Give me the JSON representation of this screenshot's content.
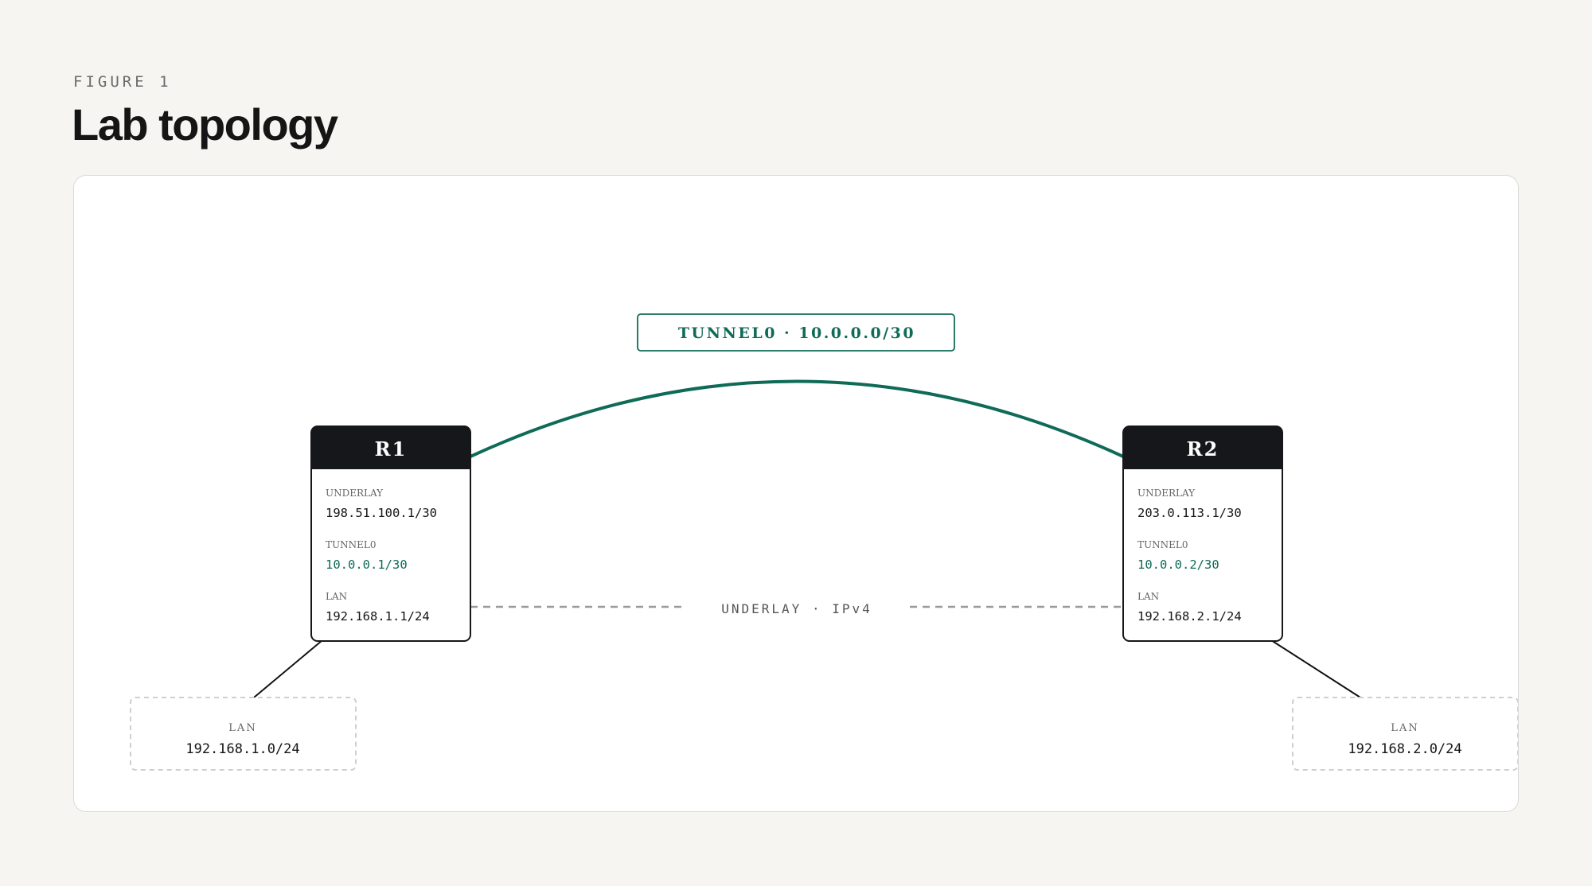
{
  "header": {
    "eyebrow": "FIGURE 1",
    "title": "Lab topology"
  },
  "colors": {
    "tunnel": "#0f6b57",
    "router_head": "#16171a",
    "underlay": "#9a9a9a",
    "lan_border": "#cfcfcf"
  },
  "diagram": {
    "tunnel_label": "TUNNEL0 · 10.0.0.0/30",
    "underlay_label": "UNDERLAY · IPv4",
    "routers": [
      {
        "name": "R1",
        "underlay_label": "UNDERLAY",
        "underlay_ip": "198.51.100.1/30",
        "tunnel_label": "TUNNEL0",
        "tunnel_ip": "10.0.0.1/30",
        "lan_label": "LAN",
        "lan_ip": "192.168.1.1/24"
      },
      {
        "name": "R2",
        "underlay_label": "UNDERLAY",
        "underlay_ip": "203.0.113.1/30",
        "tunnel_label": "TUNNEL0",
        "tunnel_ip": "10.0.0.2/30",
        "lan_label": "LAN",
        "lan_ip": "192.168.2.1/24"
      }
    ],
    "lans": [
      {
        "label": "LAN",
        "subnet": "192.168.1.0/24"
      },
      {
        "label": "LAN",
        "subnet": "192.168.2.0/24"
      }
    ]
  }
}
